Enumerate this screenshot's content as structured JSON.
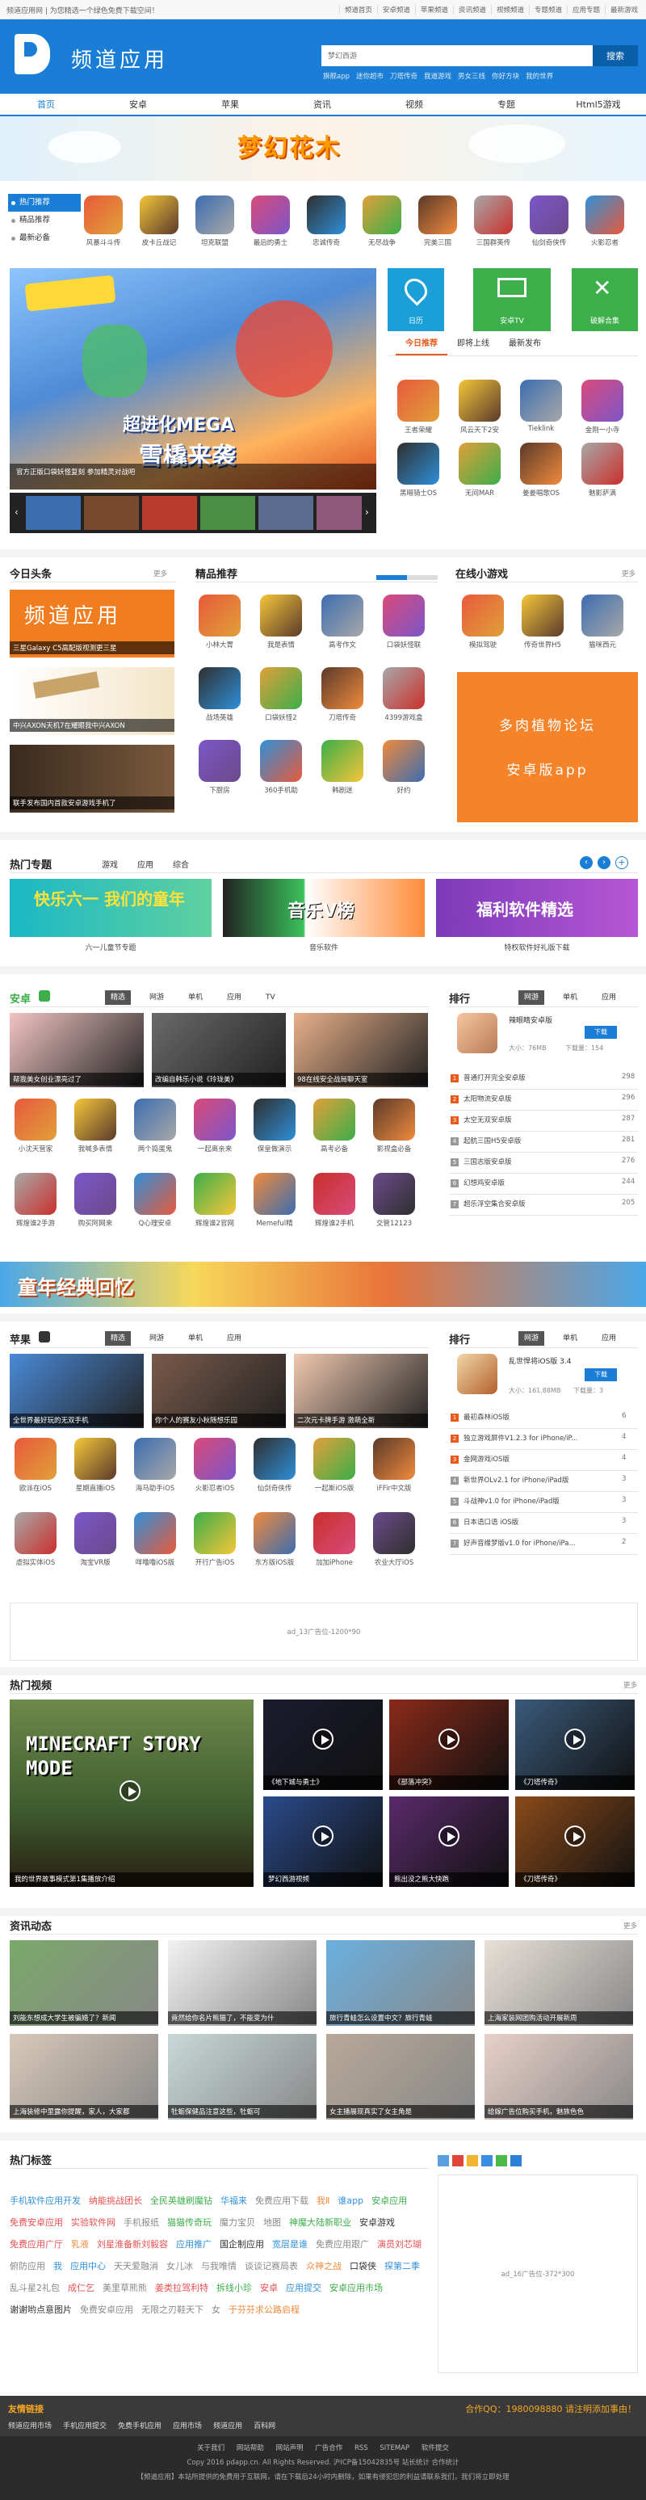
{
  "topbar": {
    "welcome": "频道应用网 | 为您精选一个绿色免费下载空间！",
    "links": [
      "频道首页",
      "安卓频道",
      "苹果频道",
      "资讯频道",
      "视频频道",
      "专题频道",
      "应用专题",
      "最新游戏"
    ]
  },
  "header": {
    "logo_text": "频道应用",
    "search_placeholder": "梦幻西游",
    "search_button": "搜索",
    "hot_links": [
      "旗舰app",
      "迷你超市",
      "刀塔传奇",
      "我道游戏",
      "男女三线",
      "你好方块",
      "我的世界"
    ]
  },
  "nav": [
    "首页",
    "安卓",
    "苹果",
    "资讯",
    "视频",
    "专题",
    "Html5游戏"
  ],
  "banner": {
    "title": "梦幻花木"
  },
  "left_list": [
    "热门推荐",
    "精品推荐",
    "最新必备"
  ],
  "top_apps": [
    {
      "label": "风暴斗斗传"
    },
    {
      "label": "皮卡丘战记"
    },
    {
      "label": "坦克联盟"
    },
    {
      "label": "最后的勇士"
    },
    {
      "label": "忠诚传奇"
    },
    {
      "label": "无尽战争"
    },
    {
      "label": "完美三国"
    },
    {
      "label": "三国群英传"
    },
    {
      "label": "仙剑奇侠传"
    },
    {
      "label": "火影忍者"
    }
  ],
  "hero": {
    "line1": "超进化MEGA",
    "line2": "雪橇来袭",
    "caption": "官方正版口袋妖怪复刻 参加精灵对战吧"
  },
  "tiles": [
    {
      "label": "日历",
      "color": "#1a9fd9"
    },
    {
      "label": "安卓TV",
      "color": "#3cae4a"
    },
    {
      "label": "破解合集",
      "color": "#3cae4a"
    }
  ],
  "today_tabs": [
    "今日推荐",
    "即将上线",
    "最新发布"
  ],
  "today_apps": [
    {
      "label": "王者荣耀"
    },
    {
      "label": "风云天下2安"
    },
    {
      "label": "Tieklink"
    },
    {
      "label": "金刚一小寺"
    },
    {
      "label": "黑暗骑士OS"
    },
    {
      "label": "无间MAR"
    },
    {
      "label": "姜姜唱歌OS"
    },
    {
      "label": "魅影萨满"
    }
  ],
  "headlines": {
    "title": "今日头条",
    "more": "更多",
    "items": [
      {
        "caption": "三星Galaxy C5高配版视测更三星"
      },
      {
        "caption": "中兴AXON天机7在耀眼我中兴AXON"
      },
      {
        "caption": "联手发布国内首款安卓游戏手机了"
      }
    ]
  },
  "picks": {
    "title": "精品推荐",
    "apps": [
      {
        "label": "小林大胃"
      },
      {
        "label": "我是表情"
      },
      {
        "label": "高考作文"
      },
      {
        "label": "口袋妖怪联"
      },
      {
        "label": "战场英雄"
      },
      {
        "label": "口袋妖怪2"
      },
      {
        "label": "刀塔传奇"
      },
      {
        "label": "4399游戏盒"
      },
      {
        "label": "下厨房"
      },
      {
        "label": "360手机助"
      },
      {
        "label": "韩剧迷"
      },
      {
        "label": "好约"
      }
    ]
  },
  "minigames": {
    "title": "在线小游戏",
    "more": "更多",
    "apps": [
      {
        "label": "模拟驾驶"
      },
      {
        "label": "传奇世界H5"
      },
      {
        "label": "猫咪西元"
      }
    ],
    "ad_line1": "多肉植物论坛",
    "ad_line2": "安卓版app"
  },
  "topics": {
    "title": "热门专题",
    "tabs": [
      "游戏",
      "应用",
      "综合"
    ],
    "cards": [
      {
        "caption": "六一儿童节专题",
        "text": "快乐六一 我们的童年"
      },
      {
        "caption": "音乐软件",
        "text": "音乐V榜"
      },
      {
        "caption": "特权软件好礼版下载",
        "text": "福利软件精选"
      }
    ]
  },
  "android": {
    "title": "安卓",
    "tabs": [
      "精选",
      "网游",
      "单机",
      "应用",
      "TV"
    ],
    "banners": [
      {
        "caption": "帮我美女创业漂亮过了"
      },
      {
        "caption": "改编自韩乐小说《玲珑美》"
      },
      {
        "caption": "98在线安全战局聊天室"
      }
    ],
    "apps": [
      {
        "label": "小沈天营家"
      },
      {
        "label": "我喊多表情"
      },
      {
        "label": "两个捣蛋鬼"
      },
      {
        "label": "一起离亲来"
      },
      {
        "label": "保皇做演示"
      },
      {
        "label": "高考必备"
      },
      {
        "label": "影视盒必备"
      },
      {
        "label": "辉煌谁2手游"
      },
      {
        "label": "购买阿网来"
      },
      {
        "label": "Q心理安卓"
      },
      {
        "label": "辉煌谁2官网"
      },
      {
        "label": "Memeful精"
      },
      {
        "label": "辉煌谁2手机"
      },
      {
        "label": "交管12123"
      }
    ]
  },
  "android_rank": {
    "title": "排行",
    "tabs": [
      "网游",
      "单机",
      "应用"
    ],
    "top": {
      "name": "辣眼睛安卓版",
      "size": "大小：76MB",
      "count": "下载量：154",
      "button": "下载"
    },
    "items": [
      {
        "name": "普通打开完全安卓版",
        "count": "298"
      },
      {
        "name": "太阳物流安卓版",
        "count": "296"
      },
      {
        "name": "太空无双安卓版",
        "count": "287"
      },
      {
        "name": "起航三国H5安卓版",
        "count": "281"
      },
      {
        "name": "三国志版安卓版",
        "count": "276"
      },
      {
        "name": "幻想鸡安卓版",
        "count": "244"
      },
      {
        "name": "超乐浮空集合安卓版",
        "count": "205"
      }
    ]
  },
  "mid_banner": {
    "text": "童年经典回忆"
  },
  "apple": {
    "title": "苹果",
    "tabs": [
      "精选",
      "网游",
      "单机",
      "应用"
    ],
    "banners": [
      {
        "caption": "全世界最好玩的无双手机"
      },
      {
        "caption": "你个人的赛友小秋随想乐园"
      },
      {
        "caption": "二次元卡牌手游 激萌全新"
      }
    ],
    "apps": [
      {
        "label": "欧派在iOS"
      },
      {
        "label": "星期直播iOS"
      },
      {
        "label": "海马助手iOS"
      },
      {
        "label": "火影忍者iOS"
      },
      {
        "label": "仙剑奇侠传"
      },
      {
        "label": "一起斯iOS版"
      },
      {
        "label": "iFFir中文版"
      },
      {
        "label": "虚拟实体iOS"
      },
      {
        "label": "淘宝VR版"
      },
      {
        "label": "咩噜噜iOS版"
      },
      {
        "label": "开行广告iOS"
      },
      {
        "label": "东方版iOS版"
      },
      {
        "label": "加加iPhone"
      },
      {
        "label": "农业大厅iOS"
      }
    ]
  },
  "apple_rank": {
    "title": "排行",
    "tabs": [
      "网游",
      "单机",
      "应用"
    ],
    "top": {
      "name": "乱世悍将iOS版 3.4",
      "size": "大小：161.88MB",
      "count": "下载量：3",
      "button": "下载"
    },
    "items": [
      {
        "name": "最初森林iOS版",
        "count": "6"
      },
      {
        "name": "独立游戏屏件V1.2.3 for iPhone/iP...",
        "count": "4"
      },
      {
        "name": "金网游戏iOS版",
        "count": "4"
      },
      {
        "name": "新世界OLv2.1 for iPhone/iPad版",
        "count": "3"
      },
      {
        "name": "斗战神v1.0 for iPhone/iPad版",
        "count": "3"
      },
      {
        "name": "日本语口语 iOS版",
        "count": "3"
      },
      {
        "name": "好声音缘梦版v1.0 for iPhone/iPa...",
        "count": "2"
      }
    ]
  },
  "ad_banner": {
    "text": "ad_13广告位-1200*90"
  },
  "videos": {
    "title": "热门视频",
    "more": "更多",
    "items": [
      {
        "caption": "我的世界故事模式第1集播放介绍"
      },
      {
        "caption": "《地下城与勇士》"
      },
      {
        "caption": "《部落冲突》"
      },
      {
        "caption": "《刀塔传奇》"
      },
      {
        "caption": "梦幻西游视频"
      },
      {
        "caption": "熊出没之熊大快跑"
      },
      {
        "caption": "《刀塔传奇》"
      }
    ],
    "minecraft_text": "MINECRAFT STORY MODE"
  },
  "news": {
    "title": "资讯动态",
    "more": "更多",
    "items": [
      {
        "caption": "刘能东想成大学生被骗婚了？新闻"
      },
      {
        "caption": "竟然给你名片熊猫了，不能变为什"
      },
      {
        "caption": "旅行青蛙怎么设置中文？旅行青蛙"
      },
      {
        "caption": "上海家装网团购活动开展新周"
      },
      {
        "caption": "上海装修中里露你提醒，家人，大家都"
      },
      {
        "caption": "牡蛎保健品注意这些，牡蛎可"
      },
      {
        "caption": "女主播展现真实了女主角是"
      },
      {
        "caption": "给嫁广告位购买手机，魅族色色"
      }
    ]
  },
  "tags": {
    "title": "热门标签",
    "items": [
      {
        "text": "手机软件应用开发",
        "color": "#2f8fd8"
      },
      {
        "text": "纳能挑战团长",
        "color": "#e84e4e"
      },
      {
        "text": "全民英雄刷魔钻",
        "color": "#3cae4a"
      },
      {
        "text": "华福来",
        "color": "#2f8fd8"
      },
      {
        "text": "免费应用下载",
        "color": "#888"
      },
      {
        "text": "我Ⅱ",
        "color": "#f08a3d"
      },
      {
        "text": "谁app",
        "color": "#2f8fd8"
      },
      {
        "text": "安卓应用",
        "color": "#3cae4a"
      },
      {
        "text": "免费安卓应用",
        "color": "#e84e4e"
      },
      {
        "text": "实验软件网",
        "color": "#e84e4e"
      },
      {
        "text": "手机报纸",
        "color": "#888"
      },
      {
        "text": "猫猫传奇玩",
        "color": "#3cae4a"
      },
      {
        "text": "魔力宝贝",
        "color": "#888"
      },
      {
        "text": "地图",
        "color": "#888"
      },
      {
        "text": "神魔大陆新职业",
        "color": "#3cae4a"
      },
      {
        "text": "安卓游戏",
        "color": "#333"
      },
      {
        "text": "免费应用广厅",
        "color": "#e84e4e"
      },
      {
        "text": "乳液",
        "color": "#f08a3d"
      },
      {
        "text": "刘星淮备新刘毅容",
        "color": "#e84e4e"
      },
      {
        "text": "应用推广",
        "color": "#2f8fd8"
      },
      {
        "text": "国企制应用",
        "color": "#333"
      },
      {
        "text": "宽层是谁",
        "color": "#2f8fd8"
      },
      {
        "text": "免费应用跟广",
        "color": "#888"
      },
      {
        "text": "演员刘芯瑚",
        "color": "#e84e4e"
      },
      {
        "text": "俯防应用",
        "color": "#888"
      },
      {
        "text": "我",
        "color": "#2f8fd8"
      },
      {
        "text": "应用中心",
        "color": "#2f8fd8"
      },
      {
        "text": "天天爱融消",
        "color": "#888"
      },
      {
        "text": "女儿冰",
        "color": "#888"
      },
      {
        "text": "与我唯情",
        "color": "#888"
      },
      {
        "text": "谈谈记赛局表",
        "color": "#888"
      },
      {
        "text": "众神之战",
        "color": "#f08a3d"
      },
      {
        "text": "口袋侠",
        "color": "#333"
      },
      {
        "text": "探第二季",
        "color": "#2f8fd8"
      },
      {
        "text": "乱斗星2礼包",
        "color": "#888"
      },
      {
        "text": "成仁乞",
        "color": "#e84e4e"
      },
      {
        "text": "美里草熊熊",
        "color": "#888"
      },
      {
        "text": "姜类拉驾利特",
        "color": "#e84e4e"
      },
      {
        "text": "拆线小珍",
        "color": "#3cae4a"
      },
      {
        "text": "安卓",
        "color": "#e84e4e"
      },
      {
        "text": "应用提交",
        "color": "#2f8fd8"
      },
      {
        "text": "安卓应用市场",
        "color": "#3cae4a"
      },
      {
        "text": "谢谢哟点意图片",
        "color": "#333"
      },
      {
        "text": "免费安卓应用",
        "color": "#888"
      },
      {
        "text": "无限之刃鞋天下",
        "color": "#888"
      },
      {
        "text": "女",
        "color": "#888"
      },
      {
        "text": "于芬芬求公路启程",
        "color": "#f08a3d"
      }
    ],
    "ad_text": "ad_16广告位-372*300"
  },
  "footer": {
    "friends": "友情链接",
    "qq": "合作QQ：1980098880 请注明添加事由！",
    "links": [
      "频道应用市场",
      "手机应用提交",
      "免费手机应用",
      "应用市场",
      "频道应用",
      "百科网"
    ],
    "nav": [
      "关于我们",
      "网站帮助",
      "网站声明",
      "广告合作",
      "RSS",
      "SITEMAP",
      "软件提交"
    ],
    "copyright": "Copy 2016 pdapp.cn. All Rights Reserved. 沪ICP备15042835号 站长统计 合作统计",
    "notice": "【频道应用】本站所提供的免费用于互联网，请在下载后24小时内删除，如果有侵犯您的利益请联系我们，我们将立即处理"
  }
}
